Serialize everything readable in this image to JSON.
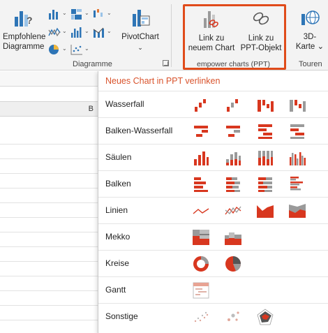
{
  "ribbon": {
    "recommended_label_1": "Empfohlene",
    "recommended_label_2": "Diagramme",
    "pivotchart_label": "PivotChart",
    "pivotchart_caret": "⌄",
    "group_charts_label": "Diagramme",
    "link_new_label_1": "Link zu",
    "link_new_label_2": "neuem Chart",
    "link_ppt_label_1": "Link zu",
    "link_ppt_label_2": "PPT-Objekt",
    "group_empower_label": "empower charts (PPT)",
    "map3d_label_1": "3D-",
    "map3d_label_2": "Karte ⌄",
    "group_tours_label": "Touren"
  },
  "sheet": {
    "column_letter": "B"
  },
  "panel": {
    "header": "Neues Chart in PPT verlinken",
    "rows": [
      {
        "label": "Wasserfall",
        "icons": [
          "waterfall-1",
          "waterfall-2",
          "waterfall-3",
          "waterfall-4"
        ]
      },
      {
        "label": "Balken-Wasserfall",
        "icons": [
          "bar-waterfall-1",
          "bar-waterfall-2",
          "bar-waterfall-3",
          "bar-waterfall-4"
        ]
      },
      {
        "label": "Säulen",
        "icons": [
          "column-1",
          "column-2",
          "column-3",
          "column-4"
        ]
      },
      {
        "label": "Balken",
        "icons": [
          "bar-1",
          "bar-2",
          "bar-3",
          "bar-4"
        ]
      },
      {
        "label": "Linien",
        "icons": [
          "line-1",
          "line-2",
          "area-1",
          "area-2"
        ]
      },
      {
        "label": "Mekko",
        "icons": [
          "mekko-1",
          "mekko-2"
        ]
      },
      {
        "label": "Kreise",
        "icons": [
          "doughnut",
          "pie"
        ]
      },
      {
        "label": "Gantt",
        "icons": [
          "gantt"
        ]
      },
      {
        "label": "Sonstige",
        "icons": [
          "scatter",
          "bubble",
          "radar"
        ]
      }
    ]
  },
  "colors": {
    "accent": "#e04b1a",
    "chart_red": "#d8371f",
    "chart_gray": "#9a9a9a",
    "panel_header": "#d9532c"
  }
}
